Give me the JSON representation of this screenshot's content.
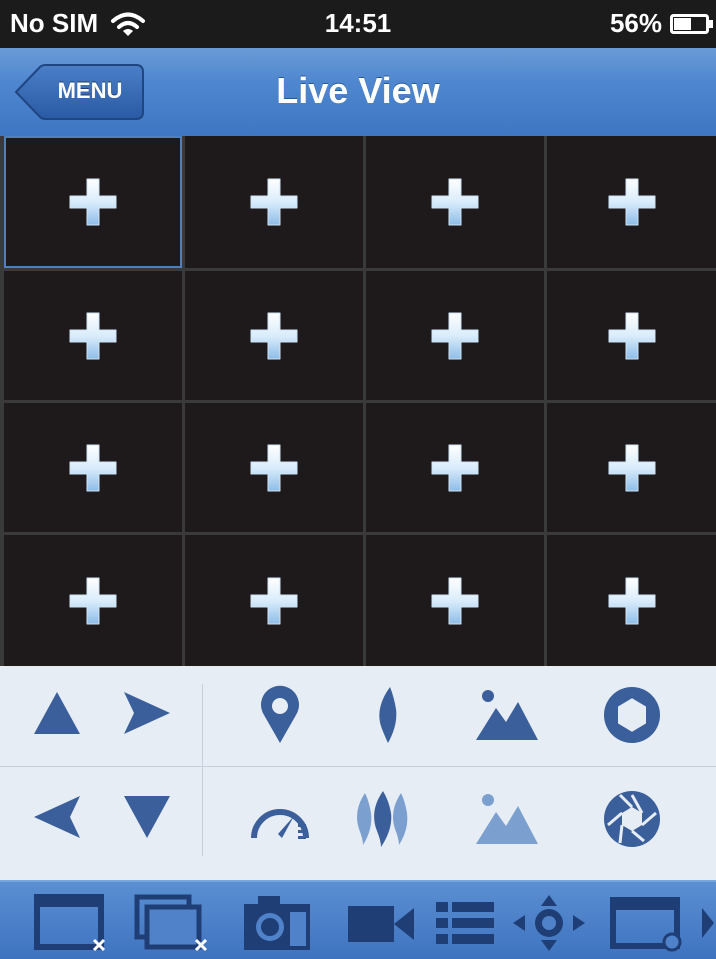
{
  "status_bar": {
    "carrier": "No SIM",
    "time": "14:51",
    "battery": "56%",
    "battery_level": 0.56,
    "wifi_icon": "wifi-icon",
    "battery_icon": "battery-icon"
  },
  "nav": {
    "back_label": "MENU",
    "title": "Live View"
  },
  "grid": {
    "rows": 4,
    "columns": 4,
    "selected_index": 0,
    "cell_icon": "add-channel-icon"
  },
  "ptz_controls": {
    "directions": [
      "up-arrow-icon",
      "right-arrow-icon",
      "left-arrow-icon",
      "down-arrow-icon"
    ],
    "functions": [
      "focus-pin-icon",
      "zoom-drop-icon",
      "brightness-mountain-icon",
      "iris-open-icon",
      "speed-gauge-icon",
      "zoom-out-drops-icon",
      "brightness-dim-icon",
      "iris-close-icon"
    ]
  },
  "toolbar": {
    "items": [
      "single-window-close-icon",
      "multi-window-close-icon",
      "camera-snapshot-icon",
      "video-record-icon",
      "list-icon",
      "ptz-direction-icon",
      "window-settings-icon",
      "more-arrow-icon"
    ]
  },
  "colors": {
    "nav_blue": "#4e86cf",
    "icon_blue": "#3a5f9b",
    "cell_bg": "#1e1a1b",
    "panel_bg": "#e6edf5"
  }
}
